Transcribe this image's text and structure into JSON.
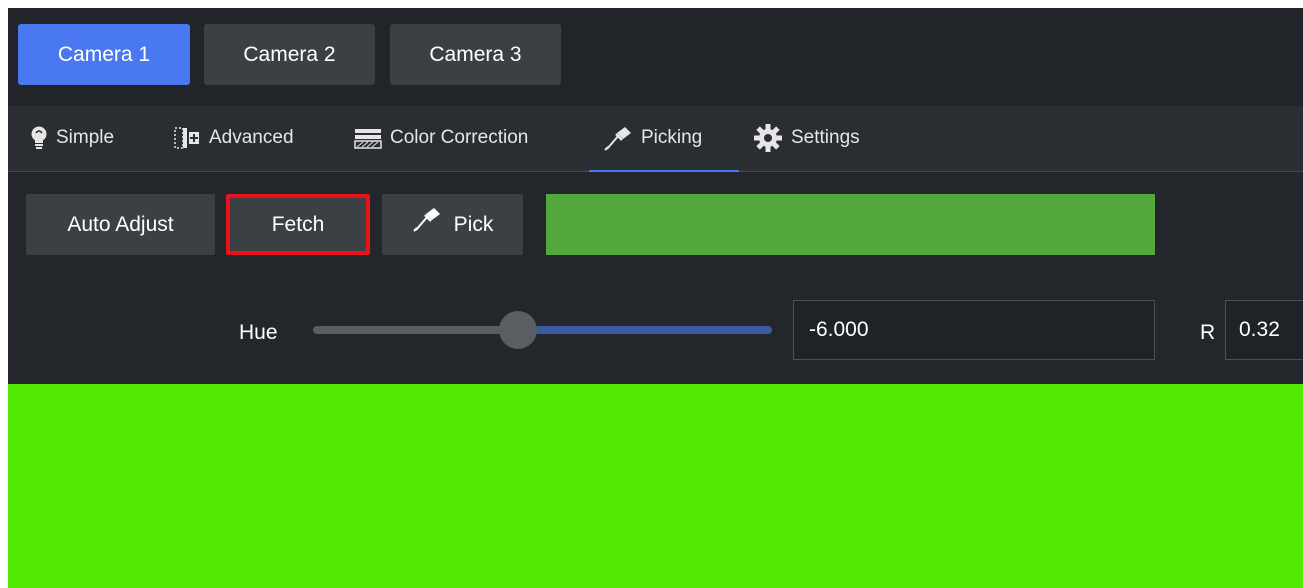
{
  "cameras": [
    {
      "label": "Camera 1",
      "active": true
    },
    {
      "label": "Camera 2",
      "active": false
    },
    {
      "label": "Camera 3",
      "active": false
    }
  ],
  "tabs": [
    {
      "label": "Simple",
      "icon": "lightbulb-icon"
    },
    {
      "label": "Advanced",
      "icon": "advanced-icon"
    },
    {
      "label": "Color Correction",
      "icon": "color-correction-icon"
    },
    {
      "label": "Picking",
      "icon": "eyedropper-icon",
      "active": true
    },
    {
      "label": "Settings",
      "icon": "gear-icon"
    }
  ],
  "picking": {
    "auto_adjust_label": "Auto Adjust",
    "fetch_label": "Fetch",
    "pick_label": "Pick",
    "swatch_color": "#53a83b",
    "hue": {
      "label": "Hue",
      "value": "-6.000",
      "slider_fraction": 0.42
    },
    "r": {
      "label": "R",
      "value": "0.32"
    }
  },
  "colors": {
    "accent": "#4a78f0",
    "highlight": "#e8131a",
    "preview": "#53ea06"
  }
}
